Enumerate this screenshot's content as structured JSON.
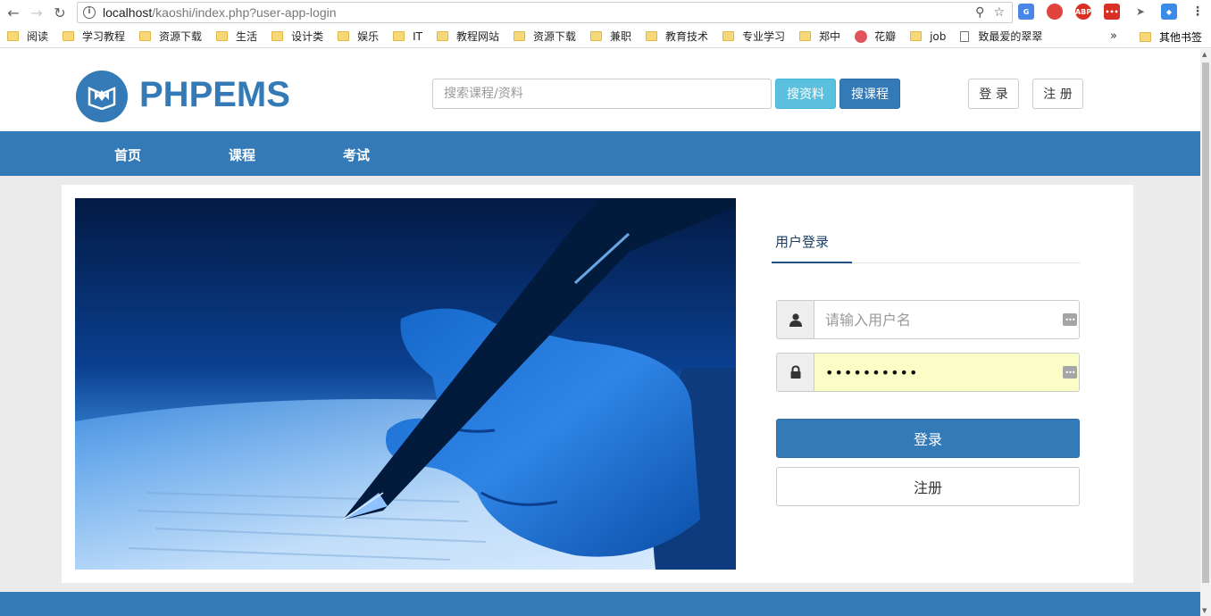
{
  "browser": {
    "url_host": "localhost",
    "url_path": "/kaoshi/index.php?user-app-login",
    "bookmarks": [
      {
        "label": "阅读",
        "icon": "folder-icon"
      },
      {
        "label": "学习教程",
        "icon": "folder-icon"
      },
      {
        "label": "资源下载",
        "icon": "folder-icon"
      },
      {
        "label": "生活",
        "icon": "folder-icon"
      },
      {
        "label": "设计类",
        "icon": "folder-icon"
      },
      {
        "label": "娱乐",
        "icon": "folder-icon"
      },
      {
        "label": "IT",
        "icon": "folder-icon"
      },
      {
        "label": "教程网站",
        "icon": "folder-icon"
      },
      {
        "label": "资源下载",
        "icon": "folder-icon"
      },
      {
        "label": "兼职",
        "icon": "folder-icon"
      },
      {
        "label": "教育技术",
        "icon": "folder-icon"
      },
      {
        "label": "专业学习",
        "icon": "folder-icon"
      },
      {
        "label": "郑中",
        "icon": "folder-icon"
      },
      {
        "label": "花瓣",
        "icon": "huaban-icon"
      },
      {
        "label": "job",
        "icon": "folder-icon"
      },
      {
        "label": "致最爱的翠翠",
        "icon": "page-icon"
      }
    ],
    "bookmarks_more": "»",
    "other_bookmarks": "其他书签"
  },
  "header": {
    "logo_text": "PHPEMS",
    "search_placeholder": "搜索课程/资料",
    "search_material_label": "搜资料",
    "search_course_label": "搜课程",
    "login_label": "登 录",
    "register_label": "注 册"
  },
  "nav": {
    "items": [
      "首页",
      "课程",
      "考试"
    ]
  },
  "login": {
    "tab_label": "用户登录",
    "username_placeholder": "请输入用户名",
    "username_value": "",
    "password_value": "••••••••••",
    "submit_label": "登录",
    "register_label": "注册"
  },
  "colors": {
    "primary": "#337ab7",
    "info": "#5bc0de",
    "autofill": "#fafdc5"
  }
}
